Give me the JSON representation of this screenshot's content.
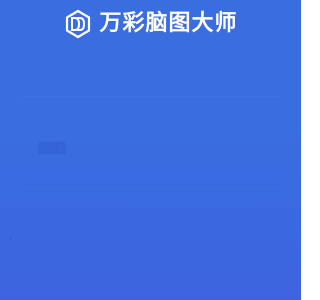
{
  "brand": {
    "logo_icon": "wancai-logo-icon",
    "name": "万彩脑图大师"
  },
  "colors": {
    "background_top": "#3a6ee0",
    "background_bottom": "#3f63e0",
    "text": "#ffffff"
  }
}
